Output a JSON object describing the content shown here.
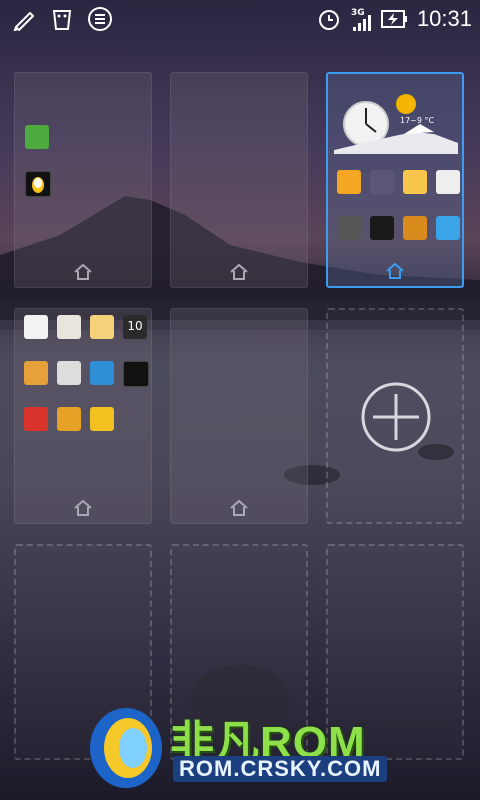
{
  "statusbar": {
    "left_icons": [
      "usb-debug-icon",
      "notification-icon",
      "app-icon"
    ],
    "network": "3G",
    "clock": "10:31"
  },
  "screens": [
    {
      "id": 1,
      "state": "page",
      "is_current": false
    },
    {
      "id": 2,
      "state": "page",
      "is_current": false
    },
    {
      "id": 3,
      "state": "page",
      "is_current": true
    },
    {
      "id": 4,
      "state": "page",
      "is_current": false
    },
    {
      "id": 5,
      "state": "page",
      "is_current": false
    },
    {
      "id": 6,
      "state": "add",
      "is_current": false
    },
    {
      "id": 7,
      "state": "empty",
      "is_current": false
    },
    {
      "id": 8,
      "state": "empty",
      "is_current": false
    },
    {
      "id": 9,
      "state": "empty",
      "is_current": false
    }
  ],
  "weather_widget": {
    "temp": "17~9 °C"
  },
  "calendar_icon_day": "10",
  "watermark": {
    "title": "非凡ROM",
    "url": "ROM.CRSKY.COM"
  },
  "colors": {
    "current_border": "#3d9bf2",
    "watermark_green": "#8ee04a",
    "watermark_blue": "#1b3f7f"
  }
}
